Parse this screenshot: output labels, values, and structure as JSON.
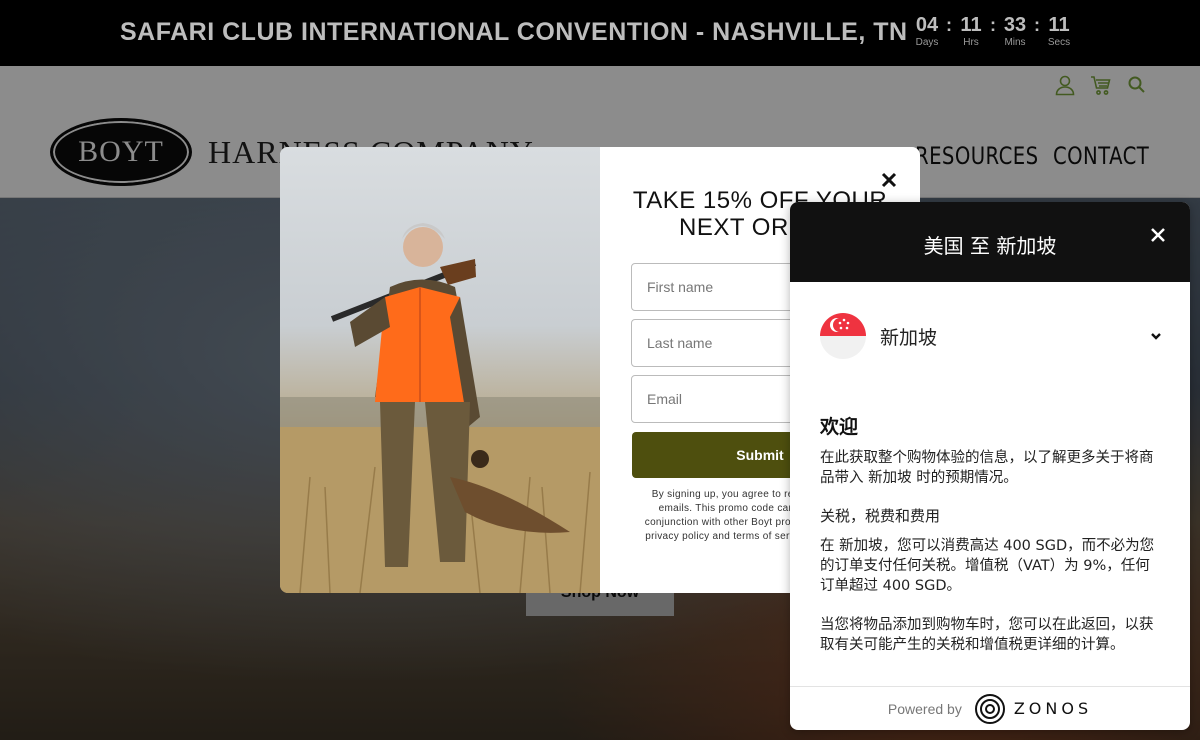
{
  "announcement": {
    "title": "SAFARI CLUB INTERNATIONAL CONVENTION - NASHVILLE, TN",
    "countdown": [
      {
        "value": "04",
        "label": "Days"
      },
      {
        "value": "11",
        "label": "Hrs"
      },
      {
        "value": "33",
        "label": "Mins"
      },
      {
        "value": "11",
        "label": "Secs"
      }
    ],
    "separator": ":"
  },
  "header": {
    "logo_oval": "BOYT",
    "logo_text": "HARNESS COMPANY",
    "nav": [
      "RESOURCES",
      "CONTACT"
    ],
    "icons": [
      "account-icon",
      "cart-icon",
      "search-icon"
    ],
    "accent_color": "#7aa53c"
  },
  "hero": {
    "button_label": "Shop Now"
  },
  "promo": {
    "close": "✕",
    "heading_line1": "TAKE 15% OFF YOUR",
    "heading_line2": "NEXT ORDER",
    "first_name_placeholder": "First name",
    "last_name_placeholder": "Last name",
    "email_placeholder": "Email",
    "submit_label": "Submit",
    "fine_print": "By signing up, you agree to receive marketing emails. This promo code cannot be used in conjunction with other Boyt promotions. View our privacy policy and terms of service for more info.",
    "submit_color": "#4e4f0e"
  },
  "zonos": {
    "title": "美国 至 新加坡",
    "country": "新加坡",
    "welcome_heading": "欢迎",
    "welcome_text": "在此获取整个购物体验的信息，以了解更多关于将商品带入 新加坡 时的预期情况。",
    "duties_heading": "关税，税费和费用",
    "duties_text": "在 新加坡，您可以消费高达 400 SGD，而不必为您的订单支付任何关税。增值税（VAT）为 9%，任何订单超过 400 SGD。",
    "return_text": "当您将物品添加到购物车时，您可以在此返回，以获取有关可能产生的关税和增值税更详细的计算。",
    "powered_by": "Powered by",
    "brand": "ZONOS"
  }
}
